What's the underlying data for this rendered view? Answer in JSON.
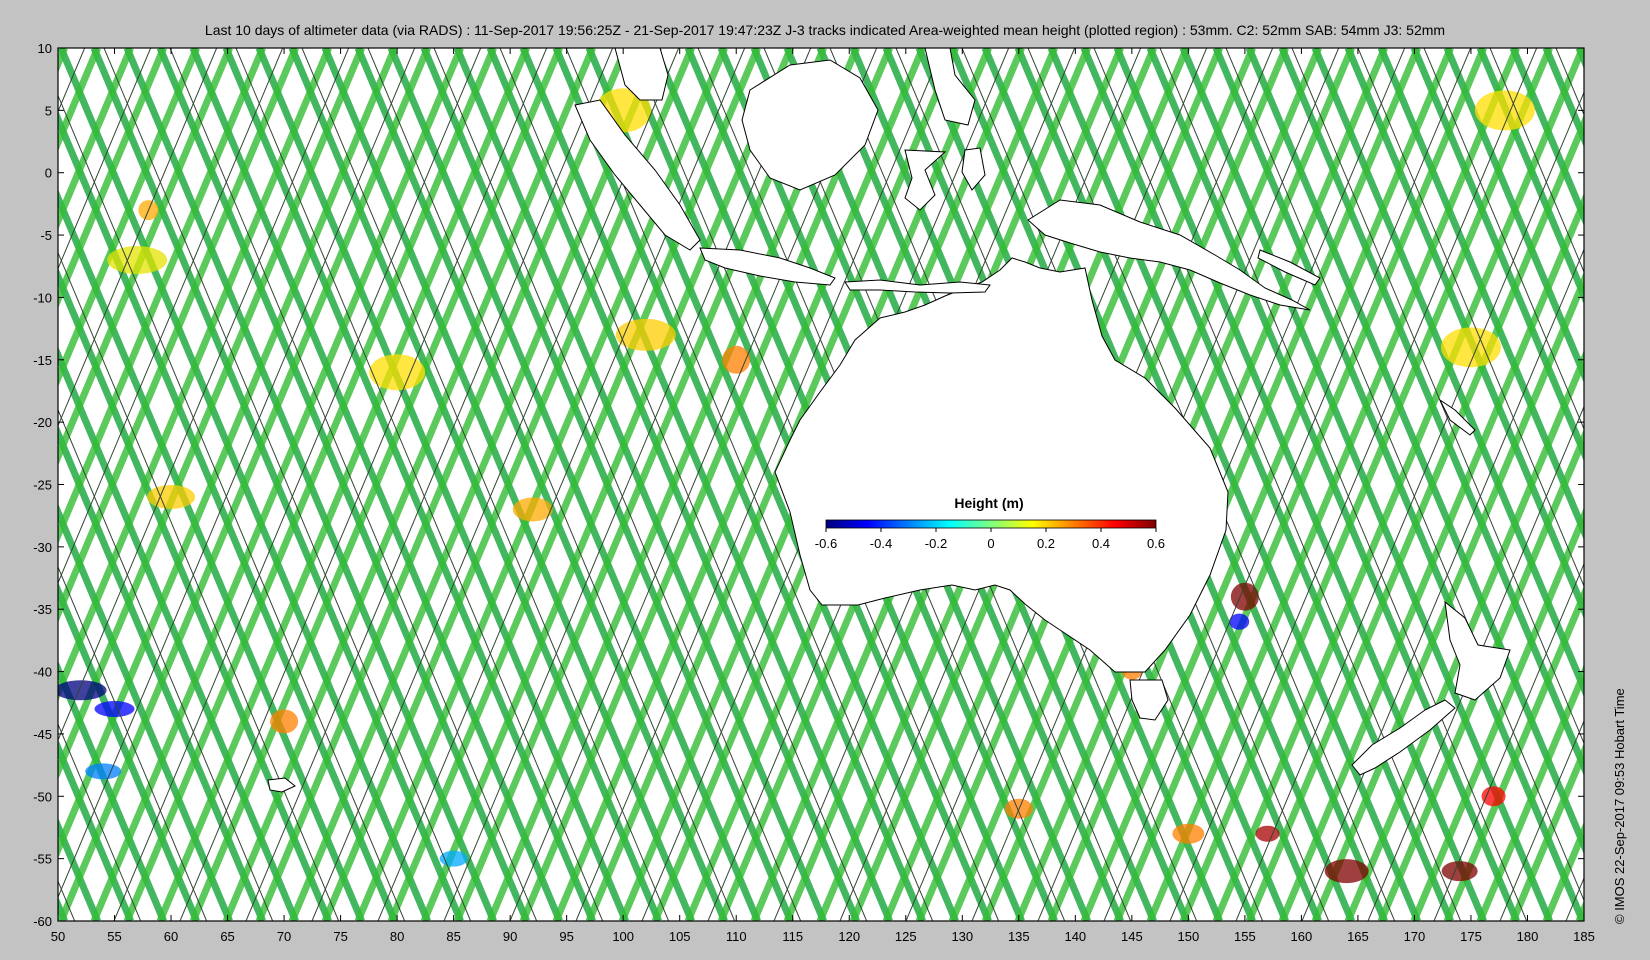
{
  "title": "Last 10 days of altimeter data (via RADS) : 11-Sep-2017 19:56:25Z - 21-Sep-2017 19:47:23Z  J-3 tracks indicated  Area-weighted mean height (plotted region) : 53mm.  C2: 52mm  SAB: 54mm  J3: 52mm",
  "credit": "© IMOS 22-Sep-2017 09:53 Hobart Time",
  "map": {
    "lon_range": [
      50,
      185
    ],
    "lat_range": [
      -60,
      10
    ],
    "x_ticks": [
      "50",
      "55",
      "60",
      "65",
      "70",
      "75",
      "80",
      "85",
      "90",
      "95",
      "100",
      "105",
      "110",
      "115",
      "120",
      "125",
      "130",
      "135",
      "140",
      "145",
      "150",
      "155",
      "160",
      "165",
      "170",
      "175",
      "180",
      "185"
    ],
    "y_ticks": [
      "10",
      "5",
      "0",
      "-5",
      "-10",
      "-15",
      "-20",
      "-25",
      "-30",
      "-35",
      "-40",
      "-45",
      "-50",
      "-55",
      "-60"
    ]
  },
  "colorbar": {
    "label": "Height (m)",
    "range": [
      -0.6,
      0.6
    ],
    "ticks": [
      "-0.6",
      "-0.4",
      "-0.2",
      "0",
      "0.2",
      "0.4",
      "0.6"
    ],
    "colormap": [
      "#00007f",
      "#0000ff",
      "#007fff",
      "#00ffff",
      "#7fff7f",
      "#ffff00",
      "#ff7f00",
      "#ff0000",
      "#7f0000"
    ]
  },
  "colors": {
    "background": "#c3c3c3",
    "land": "#ffffff",
    "track_fill": "#22aa44"
  }
}
